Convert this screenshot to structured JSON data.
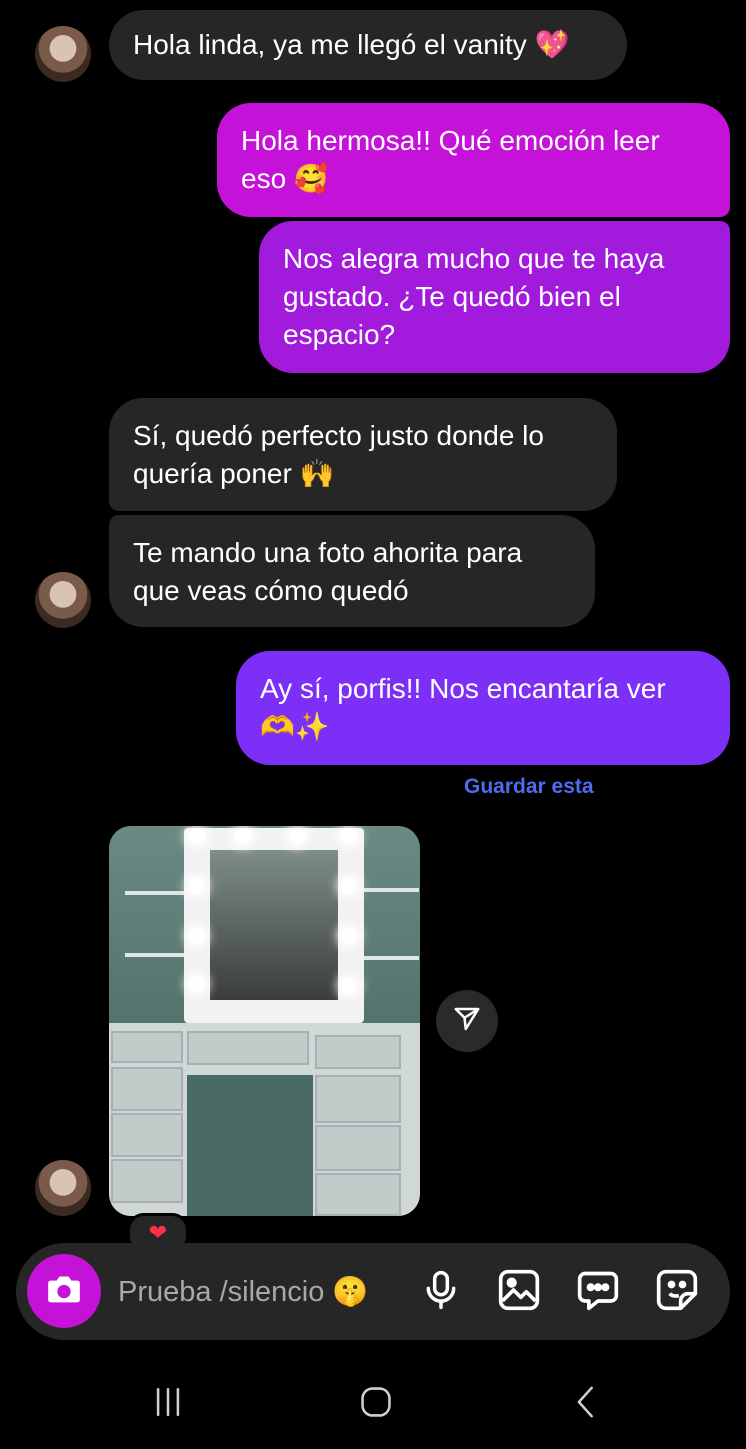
{
  "messages": [
    {
      "text": "Hola linda, ya me llegó el vanity 💖",
      "from": "them"
    },
    {
      "text": "Hola hermosa!! Qué emoción leer\neso 🥰",
      "from": "me"
    },
    {
      "text": "Nos alegra mucho que te haya\ngustado. ¿Te quedó bien el\nespacio?",
      "from": "me"
    },
    {
      "text": "Sí, quedó perfecto justo donde lo\nquería poner 🙌",
      "from": "them"
    },
    {
      "text": "Te mando una foto ahorita para\nque veas cómo quedó",
      "from": "them"
    },
    {
      "text": "Ay sí, porfis!! Nos encantaría ver\n🫶✨",
      "from": "me"
    }
  ],
  "save_link": "Guardar esta",
  "photo": {
    "reaction": "❤"
  },
  "composer": {
    "placeholder": "Prueba /silencio 🤫"
  },
  "icons": {
    "camera": "camera-icon",
    "mic": "microphone-icon",
    "gallery": "gallery-icon",
    "chat": "chat-bubble-icon",
    "sticker": "sticker-icon",
    "share": "send-icon",
    "nav_recents": "recents-icon",
    "nav_home": "home-icon",
    "nav_back": "back-icon"
  },
  "colors": {
    "background": "#000000",
    "incoming": "#262626",
    "outgoing_1": "#c512d9",
    "outgoing_2": "#a21bdc",
    "outgoing_3": "#7b2ff7",
    "link": "#4f6cf0",
    "camera": "#c512d9"
  }
}
